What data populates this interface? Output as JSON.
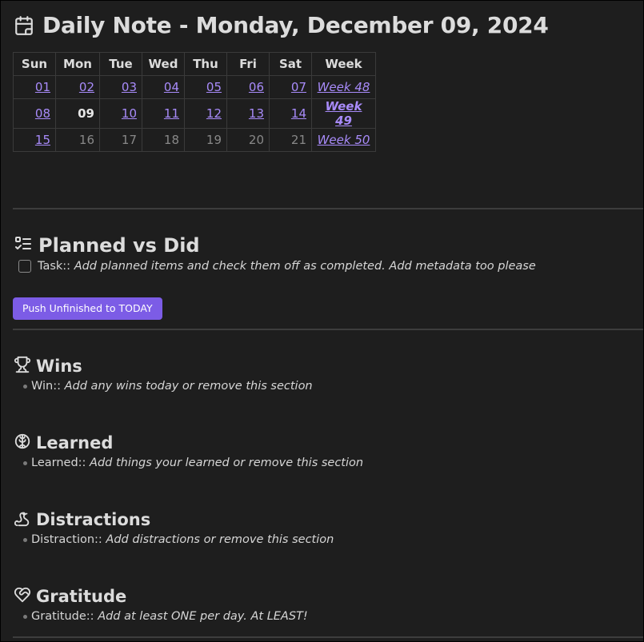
{
  "title": "Daily Note - Monday, December 09, 2024",
  "calendar": {
    "headers": [
      "Sun",
      "Mon",
      "Tue",
      "Wed",
      "Thu",
      "Fri",
      "Sat",
      "Week"
    ],
    "rows": [
      {
        "days": [
          "01",
          "02",
          "03",
          "04",
          "05",
          "06",
          "07"
        ],
        "week": "Week 48"
      },
      {
        "days": [
          "08",
          "09",
          "10",
          "11",
          "12",
          "13",
          "14"
        ],
        "week": "Week 49"
      },
      {
        "days": [
          "15",
          "16",
          "17",
          "18",
          "19",
          "20",
          "21"
        ],
        "week": "Week 50"
      }
    ]
  },
  "planned": {
    "heading": "Planned vs Did",
    "task_key": "Task::",
    "task_value": "Add planned items and check them off as completed. Add metadata too please",
    "task_checked": false,
    "push_button": "Push Unfinished to TODAY"
  },
  "wins": {
    "heading": "Wins",
    "key": "Win::",
    "value": "Add any wins today or remove this section"
  },
  "learned": {
    "heading": "Learned",
    "key": "Learned::",
    "value": "Add things your learned or remove this section"
  },
  "distractions": {
    "heading": "Distractions",
    "key": "Distraction::",
    "value": "Add distractions or remove this section"
  },
  "gratitude": {
    "heading": "Gratitude",
    "key": "Gratitude::",
    "value": "Add at least ONE per day. At LEAST!"
  },
  "colors": {
    "background": "#1e1e1e",
    "text": "#dadada",
    "accent": "#a88bfa",
    "button": "#7c5ce6",
    "muted": "#888888"
  }
}
